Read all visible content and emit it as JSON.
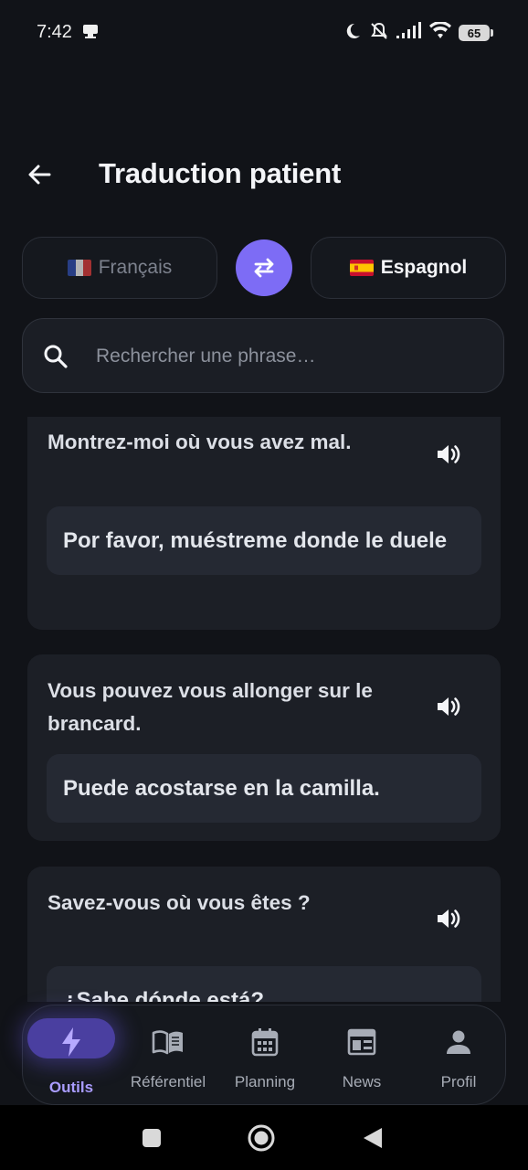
{
  "status_bar": {
    "time": "7:42",
    "battery": "65",
    "icons": [
      "notification-icon",
      "moon-icon",
      "mute-icon",
      "signal-icon",
      "wifi-icon",
      "battery-icon"
    ]
  },
  "header": {
    "title": "Traduction patient"
  },
  "languages": {
    "source": {
      "flag": "france-flag",
      "label": "Français"
    },
    "target": {
      "flag": "spain-flag",
      "label": "Espagnol"
    }
  },
  "search": {
    "placeholder": "Rechercher une phrase…",
    "value": ""
  },
  "phrases": [
    {
      "fr": "Montrez-moi où vous avez mal.",
      "es": "Por favor, muéstreme donde le duele"
    },
    {
      "fr": "Vous pouvez vous allonger sur le brancard.",
      "es": "Puede acostarse en la camilla."
    },
    {
      "fr": "Savez-vous où vous êtes ?",
      "es": "¿Sabe dónde está?"
    }
  ],
  "bottom_nav": {
    "active": "Outils",
    "items": [
      {
        "label": "Outils",
        "icon": "bolt-icon"
      },
      {
        "label": "Référentiel",
        "icon": "book-icon"
      },
      {
        "label": "Planning",
        "icon": "calendar-icon"
      },
      {
        "label": "News",
        "icon": "newspaper-icon"
      },
      {
        "label": "Profil",
        "icon": "person-icon"
      }
    ]
  },
  "colors": {
    "background": "#111318",
    "accent": "#7d6cf5",
    "card": "#1c1f26",
    "card_inner": "#252933"
  }
}
